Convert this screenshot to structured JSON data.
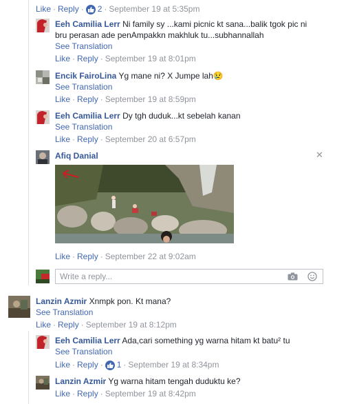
{
  "actions_labels": {
    "like": "Like",
    "reply": "Reply",
    "dot": "·"
  },
  "top_actions": {
    "like_count": "2",
    "time": "September 19 at 5:35pm"
  },
  "replies_thread_1": [
    {
      "author": "Eeh Camilia Lerr",
      "text_line1": "Ni family sy ...kami picnic kt sana...balik tgok pic ni",
      "text_line2": "bru perasan ade penAmpakkn makhluk tu...subhannallah",
      "see_translation": "See Translation",
      "time": "September 19 at 8:01pm"
    },
    {
      "author": "Encik FairoLina",
      "text": "Yg mane ni? X Jumpe lah",
      "emoji": "😢",
      "see_translation": "See Translation",
      "time": "September 19 at 8:59pm"
    },
    {
      "author": "Eeh Camilia Lerr",
      "text": "Dy tgh duduk...kt sebelah kanan",
      "see_translation": "See Translation",
      "time": "September 20 at 6:57pm"
    },
    {
      "author": "Afiq Danial",
      "time": "September 22 at 9:02am",
      "close_glyph": "✕"
    }
  ],
  "reply_box": {
    "placeholder": "Write a reply..."
  },
  "comment_2": {
    "author": "Lanzin Azmir",
    "text": "Xnmpk pon. Kt mana?",
    "see_translation": "See Translation",
    "time": "September 19 at 8:12pm"
  },
  "replies_thread_2": [
    {
      "author": "Eeh Camilia Lerr",
      "text": "Ada,cari something yg warna hitam kt batu² tu",
      "see_translation": "See Translation",
      "like_count": "1",
      "time": "September 19 at 8:34pm"
    },
    {
      "author": "Lanzin Azmir",
      "text": "Yg warna hitam tengah duduktu ke?",
      "time": "September 19 at 8:42pm"
    }
  ],
  "colors": {
    "link": "#4267b2",
    "author": "#365899",
    "muted": "#90949c",
    "line": "#dddfe2"
  },
  "icons": [
    "like-thumb-icon",
    "camera-icon",
    "smiley-icon",
    "close-icon",
    "red-arrow-icon"
  ]
}
